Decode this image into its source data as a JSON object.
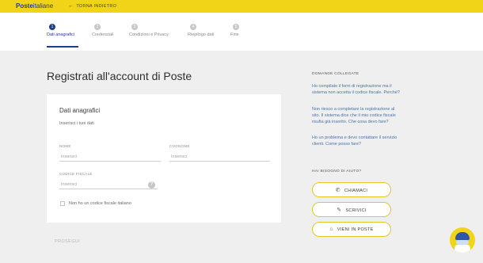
{
  "header": {
    "logo_bold": "Poste",
    "logo_rest": "italiane",
    "back_label": "TORNA INDIETRO"
  },
  "steps": [
    {
      "num": "1",
      "label": "Dati anagrafici",
      "active": true
    },
    {
      "num": "2",
      "label": "Credenziali",
      "active": false
    },
    {
      "num": "3",
      "label": "Condizioni e Privacy",
      "active": false
    },
    {
      "num": "4",
      "label": "Riepilogo dati",
      "active": false
    },
    {
      "num": "5",
      "label": "Fine",
      "active": false
    }
  ],
  "page_title": "Registrati all'account di Poste",
  "form": {
    "title": "Dati anagrafici",
    "subtitle": "Inserisci i tuoi dati",
    "nome_label": "NOME",
    "nome_placeholder": "Inserisci",
    "cognome_label": "COGNOME",
    "cognome_placeholder": "Inserisci",
    "cf_label": "CODICE FISCALE",
    "cf_placeholder": "Inserisci",
    "help_glyph": "?",
    "no_cf_label": "Non ho un codice fiscale italiano"
  },
  "proceed_label": "PROSEGUI",
  "sidebar": {
    "related_title": "DOMANDE COLLEGATE",
    "faqs": [
      "Ho compilato il form di registrazione ma il sistema non accetta il codice fiscale. Perché?",
      "Non riesco a completare la registrazione al sito. Il sistema dice che il mio codice fiscale risulta già inserito. Che cosa devo fare?",
      "Ho un problema e devo contattare il servizio clienti. Come posso fare?"
    ],
    "help_title": "HAI BISOGNO DI AIUTO?",
    "buttons": [
      {
        "label": "CHIAMACI",
        "icon": "phone-icon"
      },
      {
        "label": "SCRIVICI",
        "icon": "edit-icon"
      },
      {
        "label": "VIENI IN POSTE",
        "icon": "location-icon"
      }
    ]
  },
  "colors": {
    "brand_yellow": "#f1d417",
    "brand_blue": "#1f3e8a",
    "link_blue": "#4b72a8"
  }
}
